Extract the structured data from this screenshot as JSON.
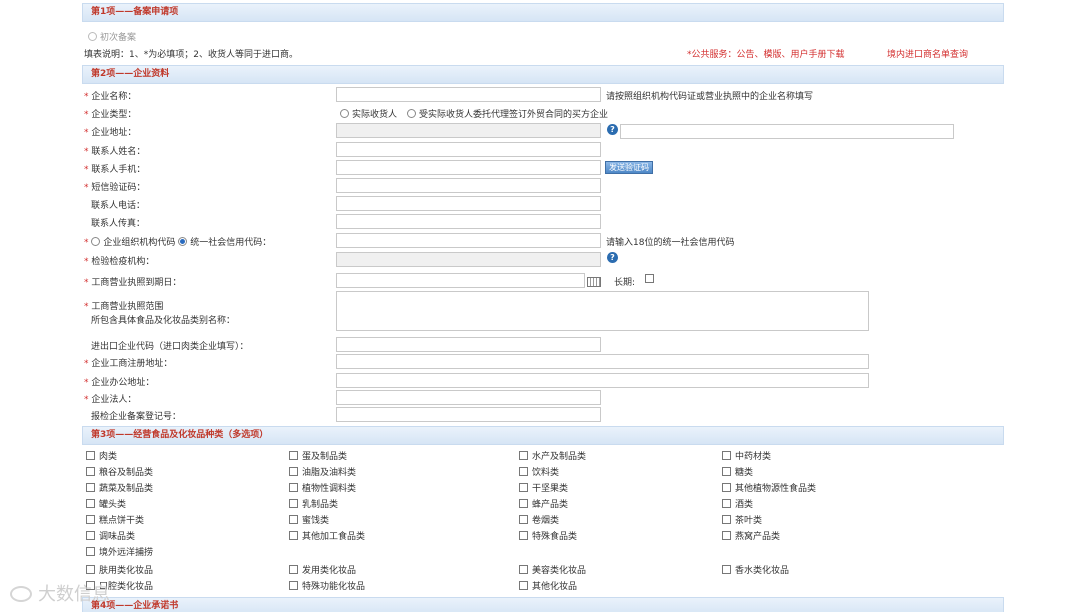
{
  "section1": {
    "title": "第1项——备案申请项",
    "first_filing": "初次备案",
    "instructions": "填表说明：1、*为必填项；2、收货人等同于进口商。",
    "public_service": "*公共服务：公告、模版、用户手册下载",
    "import_query": "境内进口商名单查询"
  },
  "section2": {
    "title": "第2项——企业资料",
    "company_name": "企业名称：",
    "company_name_hint": "请按照组织机构代码证或营业执照中的企业名称填写",
    "company_type": "企业类型：",
    "type_opt1": "实际收货人",
    "type_opt2": "受实际收货人委托代理签订外贸合同的买方企业",
    "company_address": "企业地址：",
    "contact_name": "联系人姓名：",
    "contact_mobile": "联系人手机：",
    "send_code": "发送验证码",
    "sms_code": "短信验证码：",
    "contact_phone": "联系人电话：",
    "contact_fax": "联系人传真：",
    "org_code": "企业组织机构代码",
    "credit_code": "统一社会信用代码：",
    "credit_hint": "请输入18位的统一社会信用代码",
    "inspection_org": "检验检疫机构：",
    "license_expiry": "工商营业执照到期日：",
    "long_term": "长期:",
    "business_scope_1": "工商营业执照范围",
    "business_scope_2": "所包含具体食品及化妆品类别名称：",
    "ie_code": "进出口企业代码（进口肉类企业填写）：",
    "reg_address": "企业工商注册地址：",
    "office_address": "企业办公地址：",
    "legal_person": "企业法人：",
    "filing_no": "报检企业备案登记号："
  },
  "section3": {
    "title": "第3项——经营食品及化妆品种类（多选项）",
    "col1": [
      "肉类",
      "粮谷及制品类",
      "蔬菜及制品类",
      "罐头类",
      "糕点饼干类",
      "调味品类",
      "境外远洋捕捞"
    ],
    "col2": [
      "蛋及制品类",
      "油脂及油料类",
      "植物性调料类",
      "乳制品类",
      "蜜饯类",
      "其他加工食品类"
    ],
    "col3": [
      "水产及制品类",
      "饮料类",
      "干坚果类",
      "蜂产品类",
      "卷烟类",
      "特殊食品类"
    ],
    "col4": [
      "中药材类",
      "糖类",
      "其他植物源性食品类",
      "酒类",
      "茶叶类",
      "燕窝产品类"
    ],
    "cosm1": [
      "肤用类化妆品",
      "口腔类化妆品"
    ],
    "cosm2": [
      "发用类化妆品",
      "特殊功能化妆品"
    ],
    "cosm3": [
      "美容类化妆品",
      "其他化妆品"
    ],
    "cosm4": [
      "香水类化妆品"
    ]
  },
  "section4": {
    "title": "第4项——企业承诺书"
  },
  "watermark": "大数信息"
}
